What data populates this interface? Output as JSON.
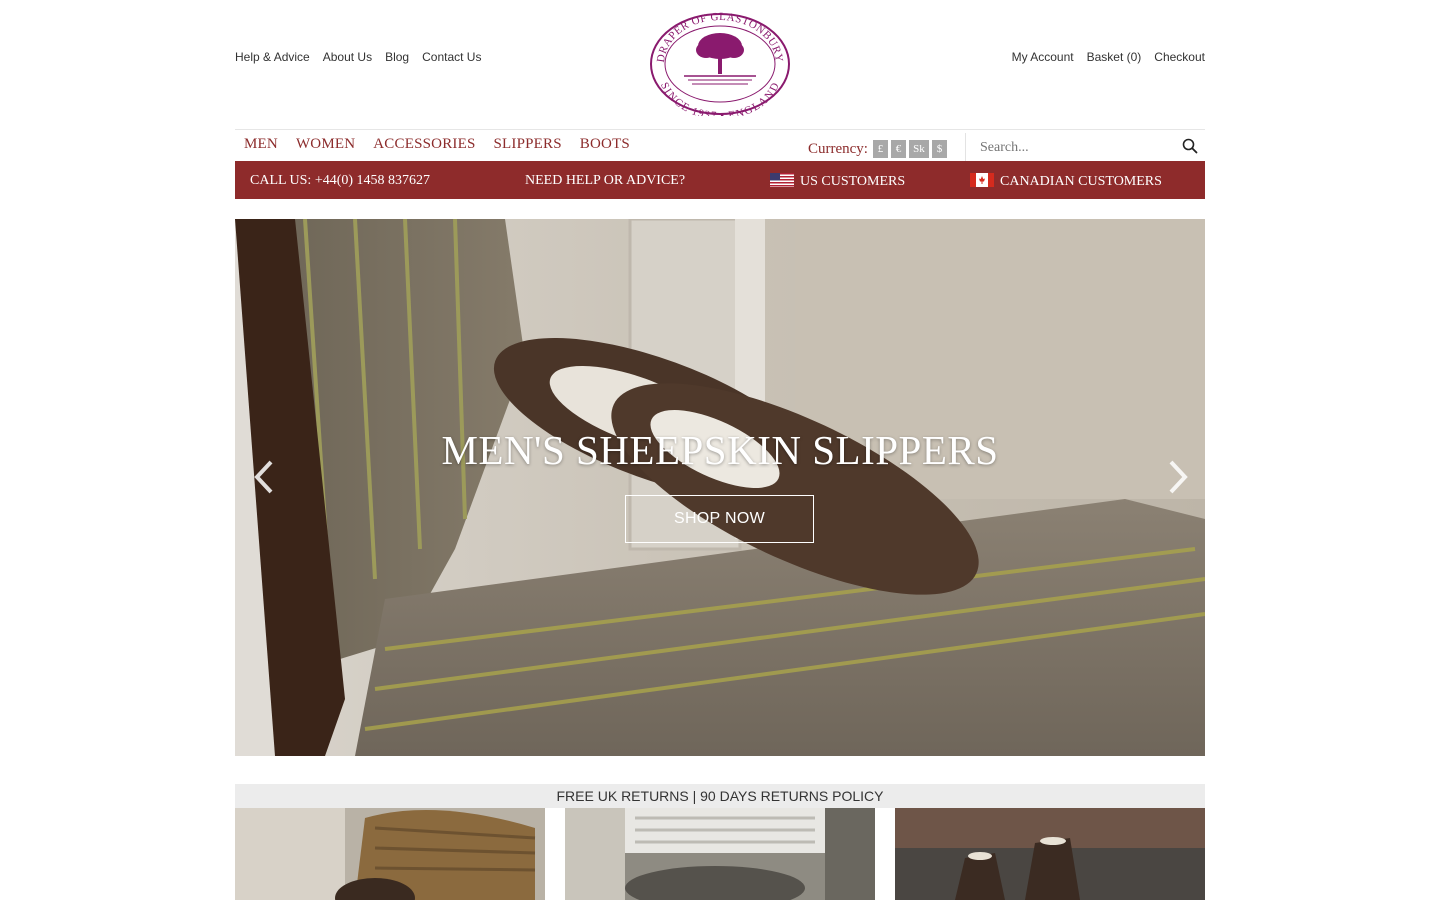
{
  "util_left": [
    "Help & Advice",
    "About Us",
    "Blog",
    "Contact Us"
  ],
  "util_right": {
    "account": "My Account",
    "basket": "Basket (0)",
    "checkout": "Checkout"
  },
  "logo": {
    "top_text": "DRAPER OF GLASTONBURY",
    "bottom_text": "SINCE 1937 • ENGLAND"
  },
  "nav": [
    "MEN",
    "WOMEN",
    "ACCESSORIES",
    "SLIPPERS",
    "BOOTS"
  ],
  "currency": {
    "label": "Currency:",
    "options": [
      "£",
      "€",
      "Sk",
      "$"
    ]
  },
  "search": {
    "placeholder": "Search..."
  },
  "redbar": {
    "call": "CALL US: +44(0) 1458 837627",
    "help": "NEED HELP OR ADVICE?",
    "us": "US CUSTOMERS",
    "canada": "CANADIAN CUSTOMERS"
  },
  "hero": {
    "title": "MEN'S SHEEPSKIN SLIPPERS",
    "cta": "SHOP NOW"
  },
  "returns": "FREE UK RETURNS | 90 DAYS RETURNS POLICY",
  "colors": {
    "brand_red": "#8e2b2b",
    "nav_red": "#8c2c2c",
    "logo_purple": "#8a1a6e"
  }
}
